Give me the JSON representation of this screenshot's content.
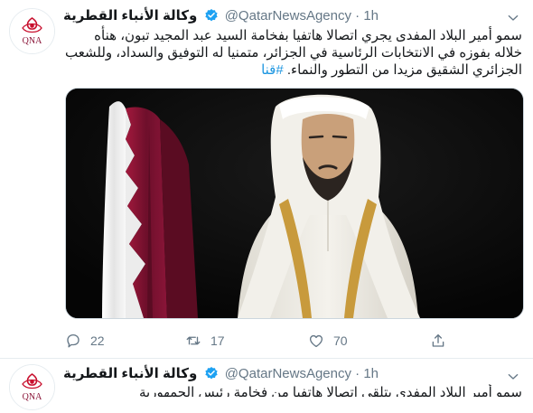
{
  "tweets": [
    {
      "author_name": "وكالة الأنباء القطرية",
      "handle": "@QatarNewsAgency",
      "separator": "·",
      "time": "1h",
      "avatar_text": "QNA",
      "body_text": "سمو أمير البلاد المفدى يجري اتصالا هاتفيا بفخامة السيد عبد المجيد تبون، هنأه خلاله بفوزه في الانتخابات الرئاسية في الجزائر، متمنيا له التوفيق والسداد، وللشعب الجزائري الشقيق مزيدا من التطور والنماء.",
      "hashtag": "#قنا",
      "replies": "22",
      "retweets": "17",
      "likes": "70"
    },
    {
      "author_name": "وكالة الأنباء القطرية",
      "handle": "@QatarNewsAgency",
      "separator": "·",
      "time": "1h",
      "avatar_text": "QNA",
      "body_text": "سمو أمير البلاد المفدى يتلقى اتصالا هاتفيا من فخامة رئيس الجمهورية"
    }
  ],
  "colors": {
    "link": "#1b95e0",
    "muted": "#657786",
    "verified": "#1da1f2",
    "flag_maroon": "#8a1538",
    "qna_red": "#c8102e"
  },
  "icons": [
    "verified-badge-icon",
    "chevron-down-icon",
    "reply-icon",
    "retweet-icon",
    "like-icon",
    "share-icon"
  ]
}
